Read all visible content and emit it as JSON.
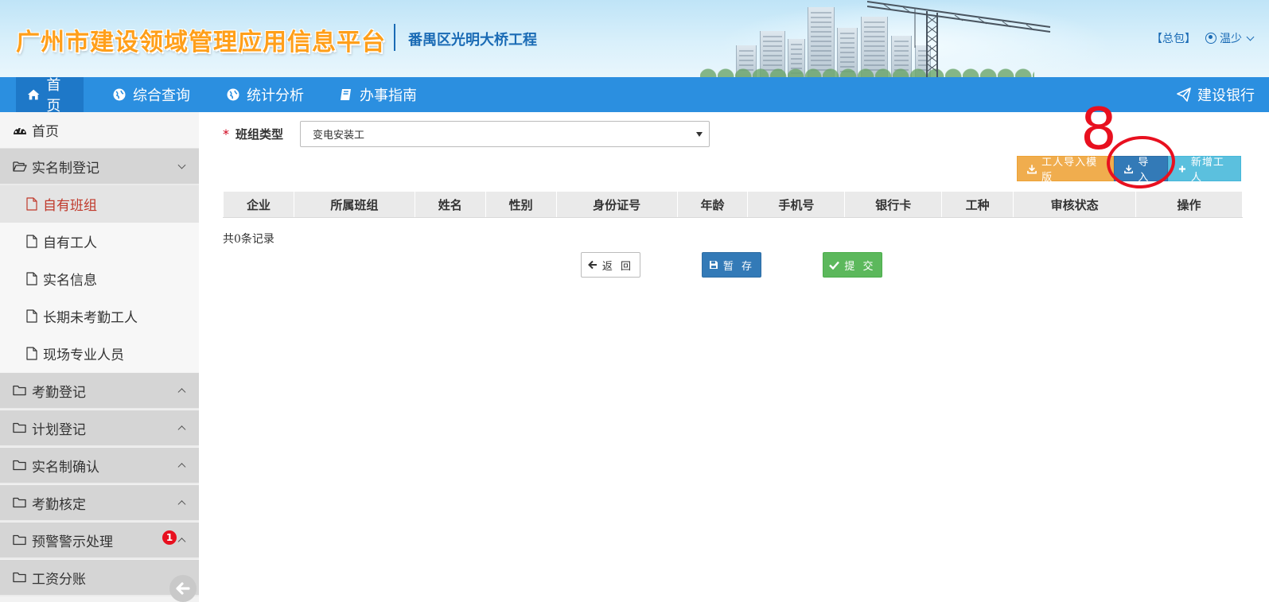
{
  "header": {
    "site_title": "广州市建设领域管理应用信息平台",
    "project_name": "番禺区光明大桥工程",
    "contractor_link": "【总包】",
    "user_name": "温少"
  },
  "nav": {
    "items": [
      {
        "label": "首页",
        "icon": "home-icon"
      },
      {
        "label": "综合查询",
        "icon": "globe-icon"
      },
      {
        "label": "统计分析",
        "icon": "globe-icon"
      },
      {
        "label": "办事指南",
        "icon": "book-icon"
      }
    ],
    "right_label": "建设银行",
    "right_icon": "paper-plane-icon"
  },
  "sidebar": {
    "home_label": "首页",
    "groups": [
      {
        "label": "实名制登记",
        "expanded": true
      },
      {
        "label": "考勤登记"
      },
      {
        "label": "计划登记"
      },
      {
        "label": "实名制确认"
      },
      {
        "label": "考勤核定"
      },
      {
        "label": "预警警示处理",
        "badge": "1"
      },
      {
        "label": "工资分账"
      }
    ],
    "sub_items": [
      "自有班组",
      "自有工人",
      "实名信息",
      "长期未考勤工人",
      "现场专业人员"
    ],
    "active_sub": "自有班组"
  },
  "form": {
    "required_mark": "*",
    "team_type_label": "班组类型",
    "team_type_value": "变电安装工"
  },
  "toolbar": {
    "template_label": "工人导入模版",
    "import_label": "导入",
    "add_label": "新增工人"
  },
  "annotation": {
    "number": "8"
  },
  "table": {
    "columns": [
      "企业",
      "所属班组",
      "姓名",
      "性别",
      "身份证号",
      "年龄",
      "手机号",
      "银行卡",
      "工种",
      "审核状态",
      "操作"
    ],
    "rows": []
  },
  "record_count": "共0条记录",
  "actions": {
    "back_label": "返 回",
    "save_label": "暂 存",
    "submit_label": "提 交"
  },
  "colors": {
    "nav_bg": "#2b8fe0",
    "title_orange": "#ff9f1a",
    "primary": "#337ab7",
    "warning": "#f0ad4e",
    "info": "#5bc0de",
    "success": "#5cb85c",
    "annotation_red": "#e8101f"
  }
}
